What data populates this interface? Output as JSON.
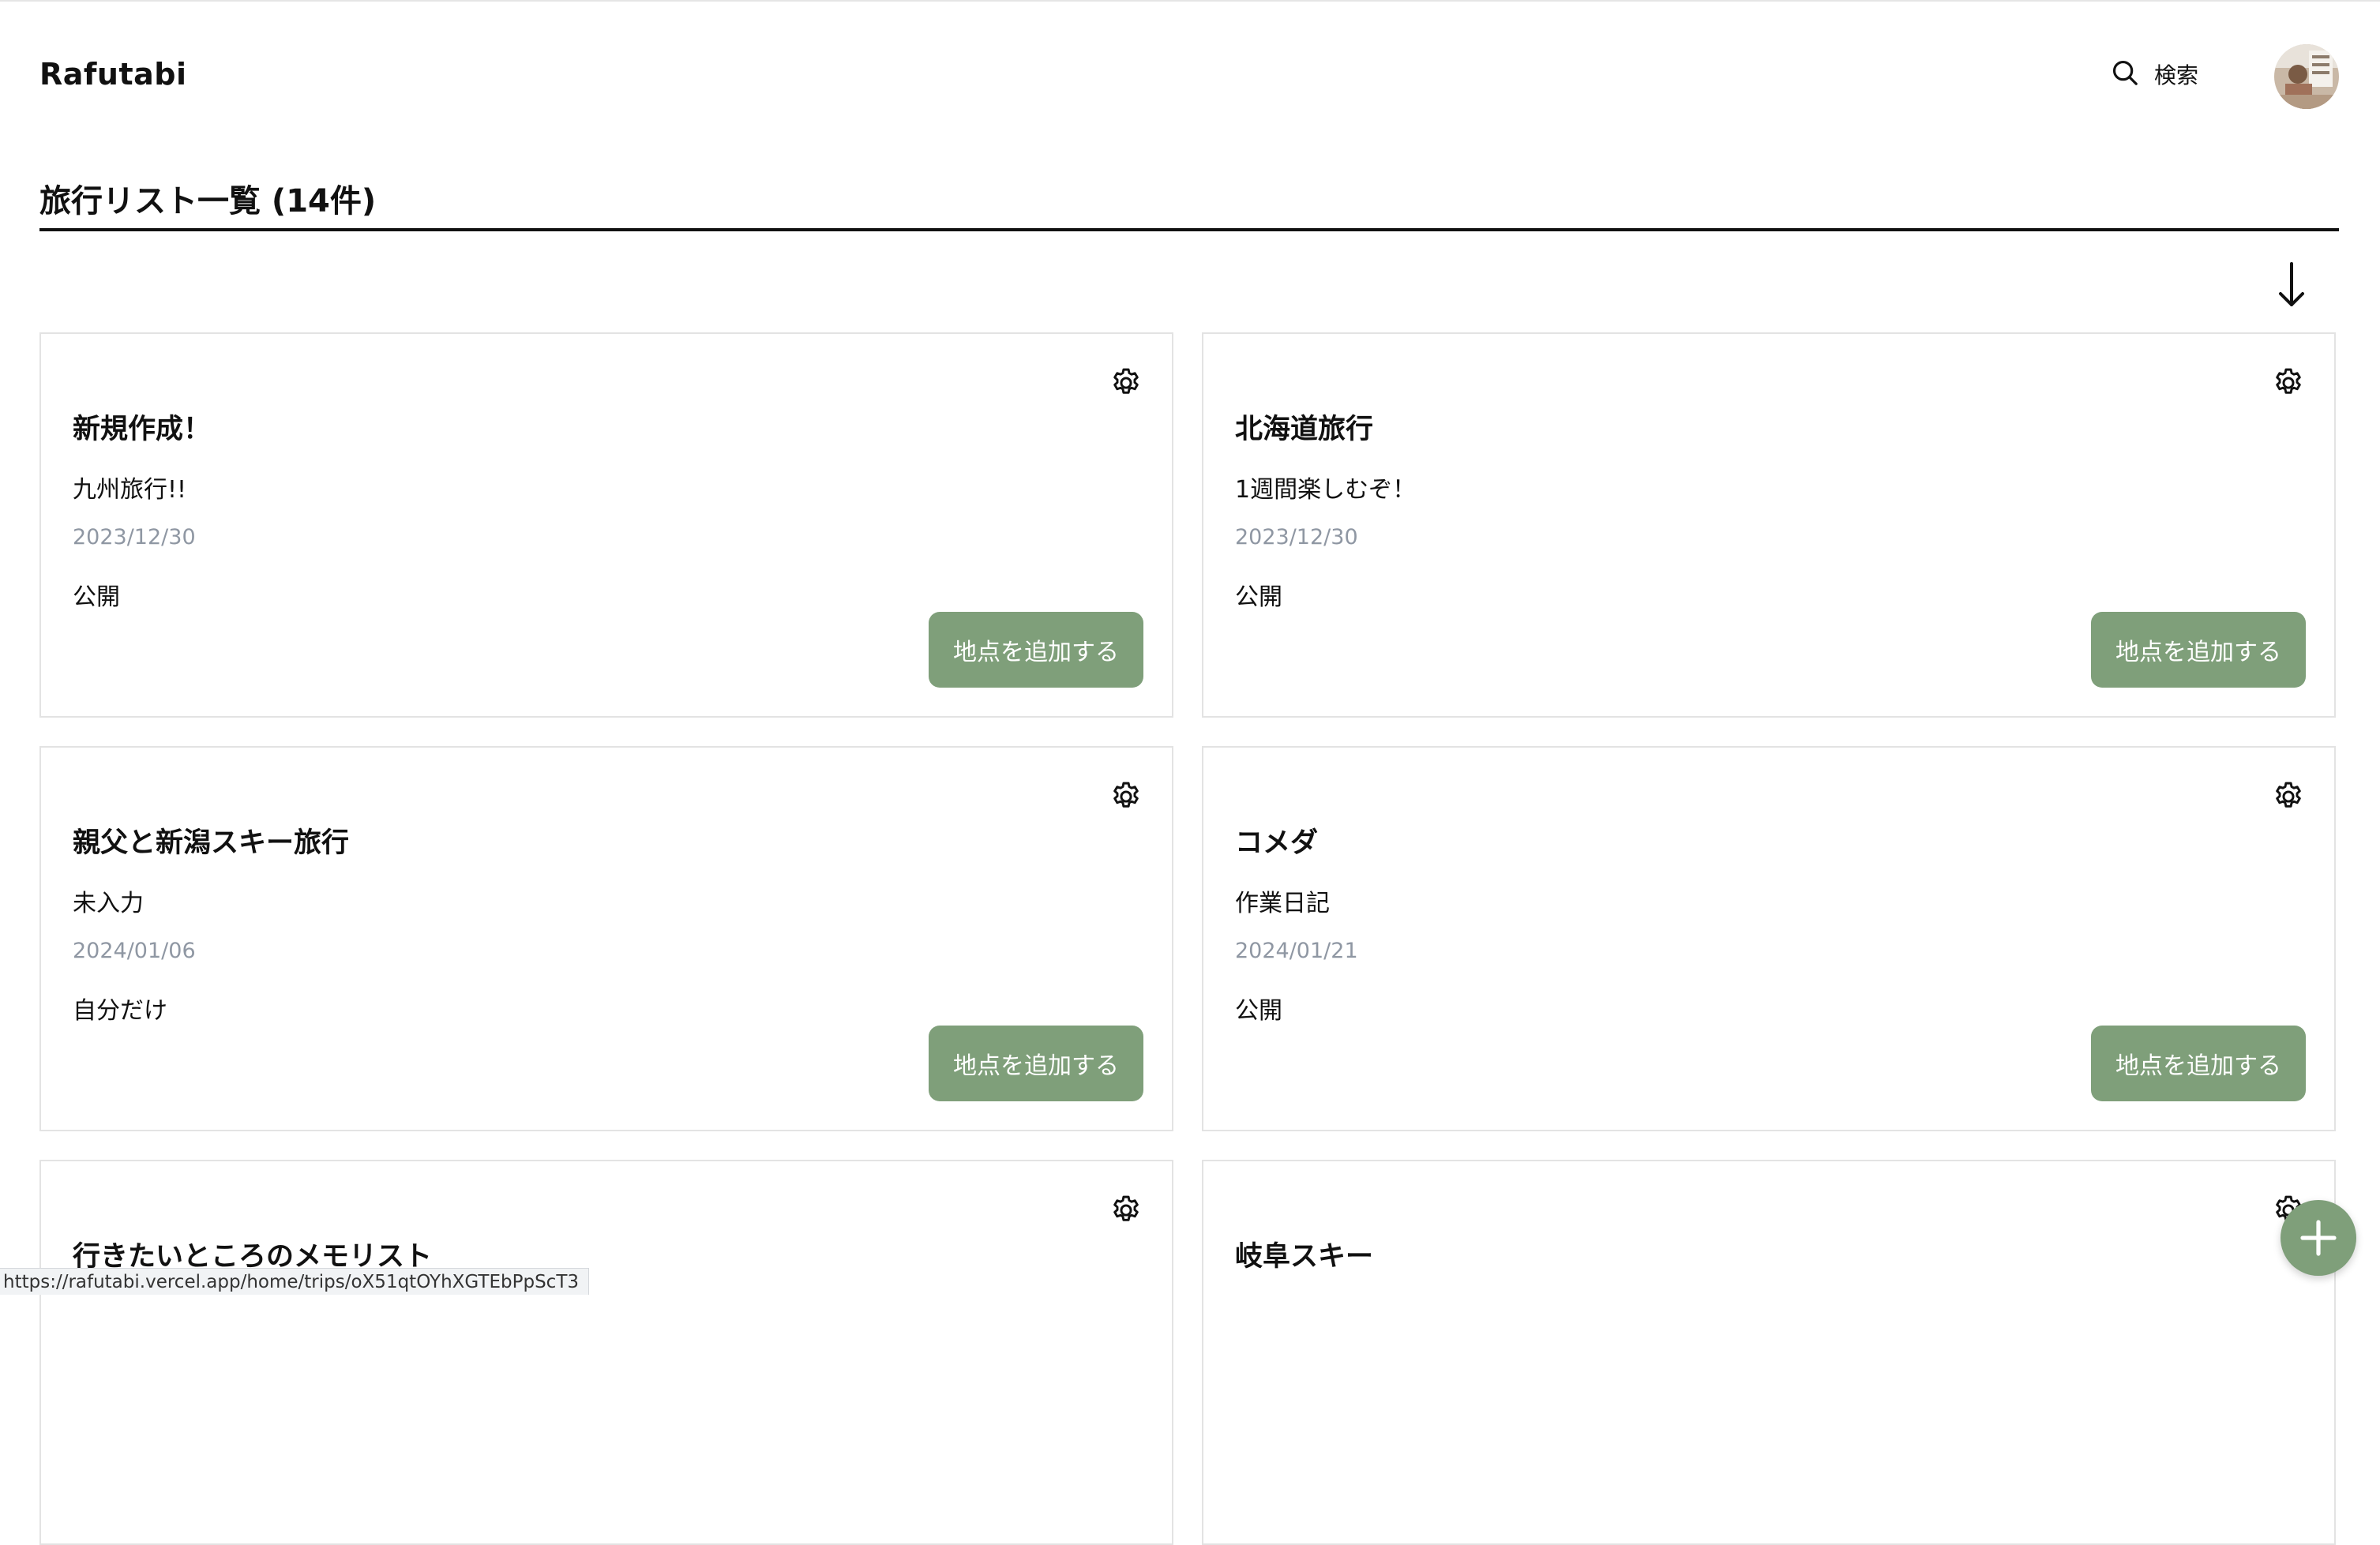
{
  "app": {
    "brand": "Rafutabi"
  },
  "header": {
    "search_label": "検索",
    "avatar_icon": "user-avatar"
  },
  "list": {
    "heading": "旅行リスト一覧 (14件)",
    "sort_icon": "arrow-down-icon"
  },
  "trips": [
    {
      "title": "新規作成！",
      "description": "九州旅行!!",
      "date": "2023/12/30",
      "visibility": "公開",
      "action": "地点を追加する"
    },
    {
      "title": "北海道旅行",
      "description": "1週間楽しむぞ！",
      "date": "2023/12/30",
      "visibility": "公開",
      "action": "地点を追加する"
    },
    {
      "title": "親父と新潟スキー旅行",
      "description": "未入力",
      "date": "2024/01/06",
      "visibility": "自分だけ",
      "action": "地点を追加する"
    },
    {
      "title": "コメダ",
      "description": "作業日記",
      "date": "2024/01/21",
      "visibility": "公開",
      "action": "地点を追加する"
    },
    {
      "title": "行きたいところのメモリスト"
    },
    {
      "title": "岐阜スキー"
    }
  ],
  "status_bar": {
    "url": "https://rafutabi.vercel.app/home/trips/oX51qtOYhXGTEbPpScT3"
  },
  "fab": {
    "icon": "plus-icon"
  },
  "colors": {
    "accent": "#7f9f7a",
    "date_text": "#8f97a3",
    "border": "#e3e3e3"
  }
}
